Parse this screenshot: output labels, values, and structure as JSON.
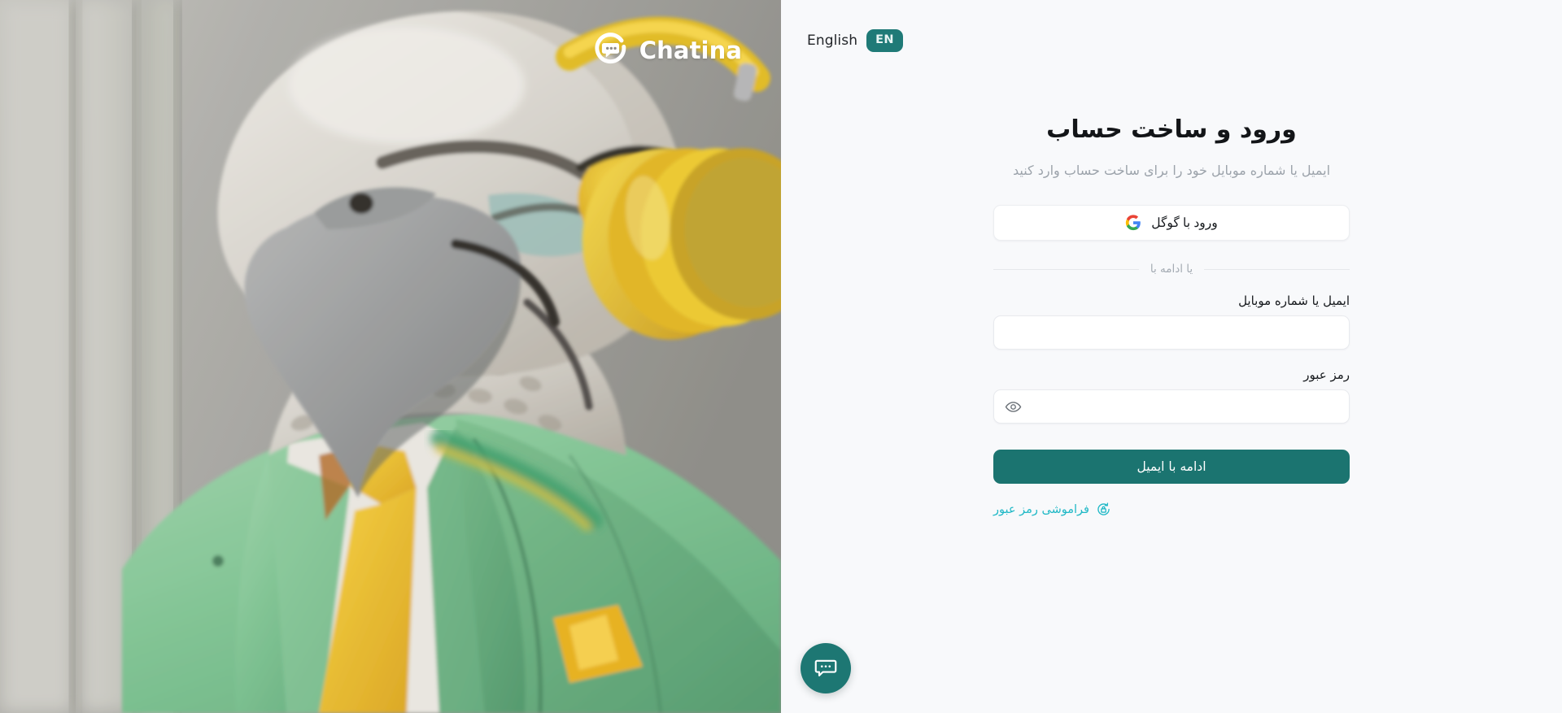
{
  "language_switch": {
    "label": "English",
    "code": "EN",
    "badge_color": "#1f7a77"
  },
  "auth": {
    "title": "ورود و ساخت حساب",
    "subtitle": "ایمیل یا شماره موبایل خود را برای ساخت حساب وارد کنید",
    "google_button_label": "ورود با گوگل",
    "google_icon": "google-logo-icon",
    "divider_label": "یا ادامه با",
    "identifier_field": {
      "label": "ایمیل یا شماره موبایل",
      "value": "",
      "placeholder": ""
    },
    "password_field": {
      "label": "رمز عبور",
      "value": "",
      "placeholder": "",
      "toggle_icon": "eye-icon"
    },
    "submit_label": "ادامه با ایمیل",
    "forgot_password_label": "فراموشی رمز عبور",
    "forgot_password_icon": "lock-reset-icon",
    "accent_color": "#1b7470",
    "link_color": "#1fb8c6"
  },
  "chat_widget": {
    "icon": "chat-bubble-icon",
    "color": "#1d7773"
  },
  "brand": {
    "name": "Chatina",
    "logo_icon": "chatina-logo-icon"
  },
  "illustration": {
    "description": "parrot-in-green-suit-with-headphones"
  }
}
